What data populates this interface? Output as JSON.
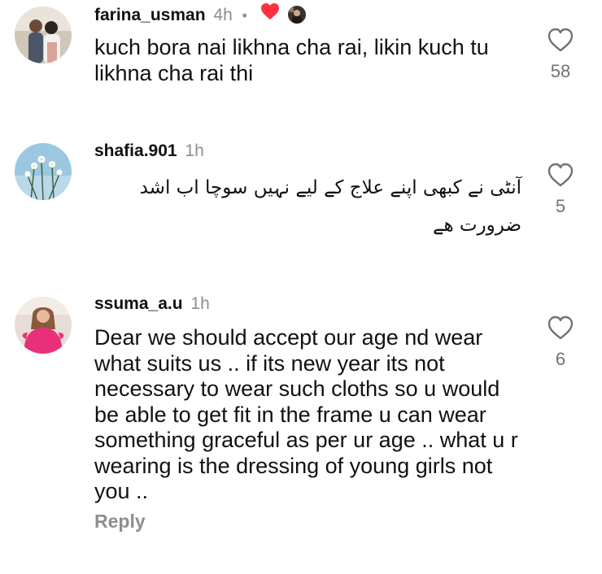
{
  "comments": [
    {
      "username": "farina_usman",
      "time": "4h",
      "separator": "•",
      "text": "kuch bora nai likhna cha rai, likin kuch tu likhna cha rai thi",
      "likes": "58",
      "liked_by_creator": true
    },
    {
      "username": "shafia.901",
      "time": "1h",
      "text": "آنٹی نے کبھی اپنے علاج کے لیے نہیں  سوچا اب اشد ضرورت ھے",
      "likes": "5"
    },
    {
      "username": "ssuma_a.u",
      "time": "1h",
      "text": "Dear we should accept our age nd wear what suits us .. if its new year its not necessary  to wear such cloths so u would be able to get fit in the frame u can wear something graceful as per ur age .. what u r wearing is the dressing of young girls not you ..",
      "likes": "6",
      "reply_label": "Reply"
    }
  ],
  "colors": {
    "heart_red": "#ff3040",
    "muted": "#8e8e8e",
    "text": "#111111"
  },
  "icons": {
    "like": "heart-outline-icon",
    "creator_like": "heart-filled-icon"
  }
}
